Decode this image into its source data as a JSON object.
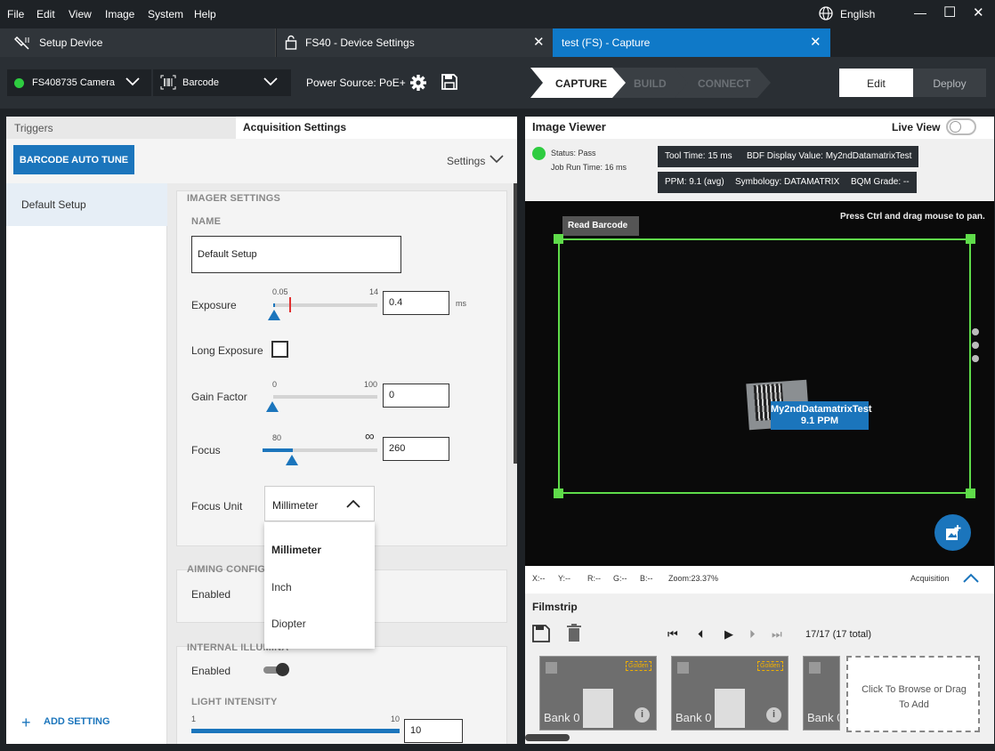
{
  "menu": [
    "File",
    "Edit",
    "View",
    "Image",
    "System",
    "Help"
  ],
  "language": "English",
  "window_controls": {
    "minimize": "—",
    "maximize": "☐",
    "close": "✕"
  },
  "tabs": [
    {
      "label": "Setup Device",
      "icon": "barcode-reader-icon"
    },
    {
      "label": "FS40 - Device Settings",
      "icon": "lock-icon"
    },
    {
      "label": "test  (FS) - Capture",
      "active": true
    }
  ],
  "toolbar": {
    "camera": "FS408735 Camera",
    "mode": "Barcode",
    "power_source": "Power Source: PoE+",
    "steps": [
      "CAPTURE",
      "BUILD",
      "CONNECT"
    ],
    "edit": "Edit",
    "deploy": "Deploy"
  },
  "left": {
    "tabs": [
      "Triggers",
      "Acquisition Settings"
    ],
    "autotune_button": "BARCODE AUTO TUNE",
    "settings_dropdown": "Settings",
    "setups": [
      "Default Setup"
    ],
    "add_setting": "ADD SETTING",
    "imager": {
      "section": "IMAGER SETTINGS",
      "name_label": "NAME",
      "name_value": "Default Setup",
      "exposure": {
        "label": "Exposure",
        "min": "0.05",
        "max": "14",
        "value": "0.4",
        "unit": "ms"
      },
      "long_exposure": {
        "label": "Long Exposure",
        "checked": false
      },
      "gain": {
        "label": "Gain Factor",
        "min": "0",
        "max": "100",
        "value": "0"
      },
      "focus": {
        "label": "Focus",
        "min": "80",
        "max": "∞",
        "value": "260"
      },
      "focus_unit": {
        "label": "Focus Unit",
        "value": "Millimeter",
        "options": [
          "Millimeter",
          "Inch",
          "Diopter"
        ]
      }
    },
    "aiming": {
      "section": "AIMING CONFIGUR",
      "enabled_label": "Enabled"
    },
    "illumination": {
      "section": "INTERNAL ILLUMINA",
      "enabled_label": "Enabled",
      "intensity_label": "LIGHT INTENSITY",
      "min": "1",
      "max": "10",
      "value": "10"
    }
  },
  "viewer": {
    "title": "Image Viewer",
    "live_view": "Live View",
    "status": "Status:  Pass",
    "job_run_time": "Job Run Time:  16 ms",
    "chips": [
      "Tool Time:  15 ms",
      "BDF Display Value:  My2ndDatamatrixTest",
      "PPM:  9.1 (avg)",
      "Symbology:  DATAMATRIX",
      "BQM Grade:  --"
    ],
    "hint": "Press Ctrl and drag mouse to pan.",
    "tool_label": "Read Barcode",
    "decoded": "My2ndDatamatrixTest",
    "ppm": "9.1 PPM",
    "coords": {
      "x": "X:--",
      "y": "Y:--",
      "r": "R:--",
      "g": "G:--",
      "b": "B:--",
      "zoom": "Zoom:23.37%"
    },
    "acquisition": "Acquisition"
  },
  "filmstrip": {
    "title": "Filmstrip",
    "count": "17/17 (17 total)",
    "cards": [
      {
        "label": "Bank 0",
        "badge": "Golden"
      },
      {
        "label": "Bank 0",
        "badge": "Golden"
      },
      {
        "label": "Bank 0",
        "badge": ""
      }
    ],
    "drop_zone": "Click To Browse or Drag To Add"
  },
  "colors": {
    "accent": "#1b75bc",
    "active_tab": "#0f79c8",
    "pass": "#2ecc40",
    "roi": "#5fdc4a"
  }
}
